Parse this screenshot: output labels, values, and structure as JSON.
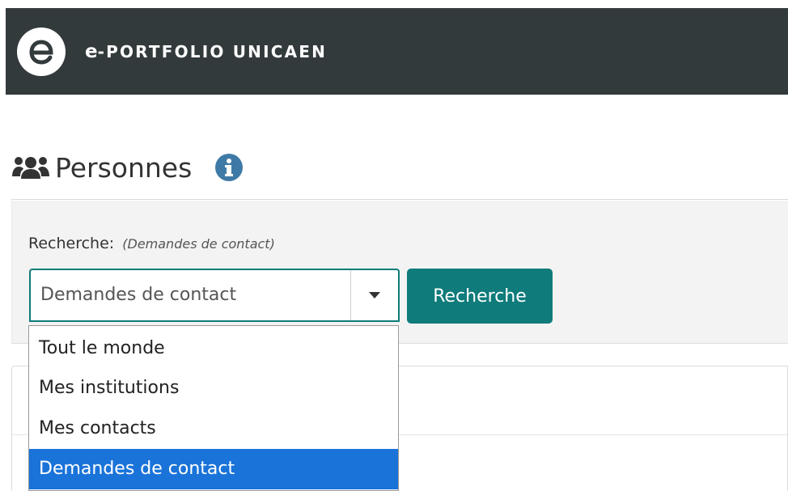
{
  "header": {
    "brand_letter": "e",
    "brand_rest": "-PORTFOLIO UNICAEN"
  },
  "page": {
    "title": "Personnes"
  },
  "search": {
    "label": "Recherche:",
    "hint": "(Demandes de contact)",
    "selected_value": "Demandes de contact",
    "button_label": "Recherche",
    "options": [
      "Tout le monde",
      "Mes institutions",
      "Mes contacts",
      "Demandes de contact"
    ]
  },
  "colors": {
    "header_bg": "#333a3c",
    "accent": "#0f7b7b",
    "info_icon": "#3f7aa6",
    "selected_option": "#1a73d9"
  },
  "icons": {
    "logo": "e-logo-icon",
    "users": "users-icon",
    "info": "info-icon",
    "dropdown": "caret-down-icon"
  }
}
